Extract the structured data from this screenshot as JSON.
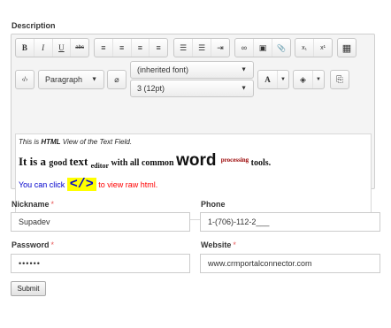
{
  "description_label": "Description",
  "toolbar": {
    "bold": "B",
    "italic": "I",
    "underline": "U",
    "strike": "abc",
    "align_left": "≡",
    "align_center": "≡",
    "align_right": "≡",
    "justify": "≡",
    "bullets": "☰",
    "numbered": "☰",
    "indent": "⇥",
    "link": "∞",
    "image": "▣",
    "attach": "📎",
    "subscript": "x₁",
    "superscript": "x¹",
    "table": "▦",
    "source": "‹/›",
    "format_value": "Paragraph",
    "clear": "⌀",
    "font_value": "(inherited font)",
    "size_value": "3 (12pt)",
    "text_color": "A",
    "highlight": "◈",
    "paste": "⎘"
  },
  "editor_content": {
    "line1_pre": "This is ",
    "line1_bold": "HTML",
    "line1_post": " View of the Text Field.",
    "w_it_is_a": "It is a ",
    "w_good": "good ",
    "w_text": "text ",
    "w_editor": "editor",
    "w_with": " with all common ",
    "w_word": "word ",
    "w_processing": "processing",
    "w_tools": " tools.",
    "click_pre": "You can click ",
    "click_tag": "</>",
    "click_post": " to view raw html."
  },
  "form": {
    "nickname_label": "Nickname",
    "nickname_value": "Supadev",
    "phone_label": "Phone",
    "phone_value": "1-(706)-112-2___",
    "password_label": "Password",
    "password_value": "••••••",
    "website_label": "Website",
    "website_value": "www.crmportalconnector.com",
    "required_mark": "*",
    "submit_label": "Submit"
  },
  "colors": {
    "required": "#e85a5a",
    "highlight_yellow": "#ffff00",
    "link_blue": "#0000cc",
    "maroon": "#990000",
    "red_text": "#ff0000"
  }
}
